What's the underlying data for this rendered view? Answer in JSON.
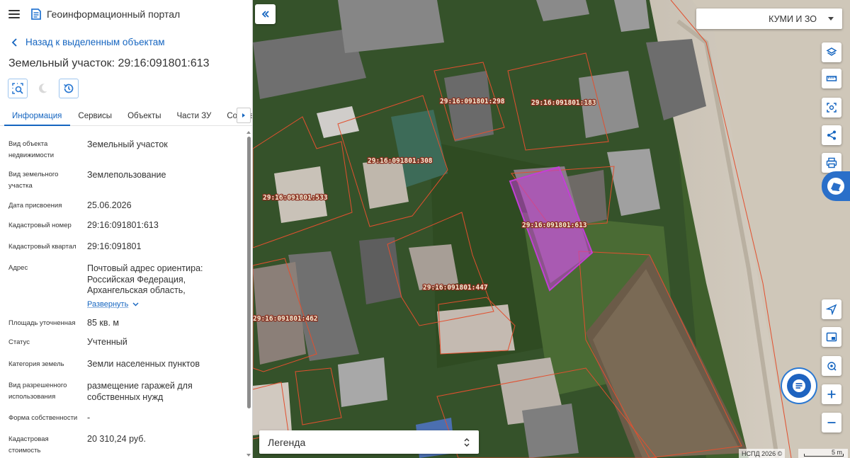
{
  "app": {
    "title": "Геоинформационный портал"
  },
  "nav": {
    "back_label": "Назад к выделенным объектам"
  },
  "object": {
    "title": "Земельный участок: 29:16:091801:613"
  },
  "tools": [
    "zoom-to-object-icon",
    "moon-icon",
    "history-icon"
  ],
  "tabs": [
    {
      "label": "Информация",
      "active": true
    },
    {
      "label": "Сервисы"
    },
    {
      "label": "Объекты"
    },
    {
      "label": "Части ЗУ"
    },
    {
      "label": "Состав"
    }
  ],
  "properties": [
    {
      "label": "Вид объекта недвижимости",
      "value": "Земельный участок"
    },
    {
      "label": "Вид земельного участка",
      "value": "Землепользование"
    },
    {
      "label": "Дата присвоения",
      "value": "25.06.2026"
    },
    {
      "label": "Кадастровый номер",
      "value": "29:16:091801:613"
    },
    {
      "label": "Кадастровый квартал",
      "value": "29:16:091801"
    },
    {
      "label": "Адрес",
      "value": "Почтовый адрес ориентира: Российская Федерация, Архангельская область,",
      "expand_label": "Развернуть"
    },
    {
      "label": "Площадь уточненная",
      "value": "85 кв. м"
    },
    {
      "label": "Статус",
      "value": "Учтенный"
    },
    {
      "label": "Категория земель",
      "value": "Земли населенных пунктов"
    },
    {
      "label": "Вид разрешенного использования",
      "value": "размещение гаражей для собственных нужд"
    },
    {
      "label": "Форма собственности",
      "value": "-"
    },
    {
      "label": "Кадастровая стоимость",
      "value": "20 310,24 руб."
    }
  ],
  "map": {
    "layer_select": "КУМИ И ЗО",
    "legend_label": "Легенда",
    "attribution": "НСПД 2026 ©",
    "scale_label": "5 m",
    "plot_labels": [
      "29:16:091801:298",
      "29:16:091801:183",
      "29:16:091801:308",
      "29:16:091801:533",
      "29:16:091801:613",
      "29:16:091801:447",
      "29:16:091801:462"
    ],
    "right_tools": [
      "layers-icon",
      "ruler-icon",
      "area-select-icon",
      "share-icon",
      "print-icon"
    ],
    "bottom_tools": [
      "locate-arrow-icon",
      "minimap-icon",
      "geolocation-icon"
    ],
    "selected_color": "#c33fd6",
    "boundary_color": "#e2502f"
  }
}
